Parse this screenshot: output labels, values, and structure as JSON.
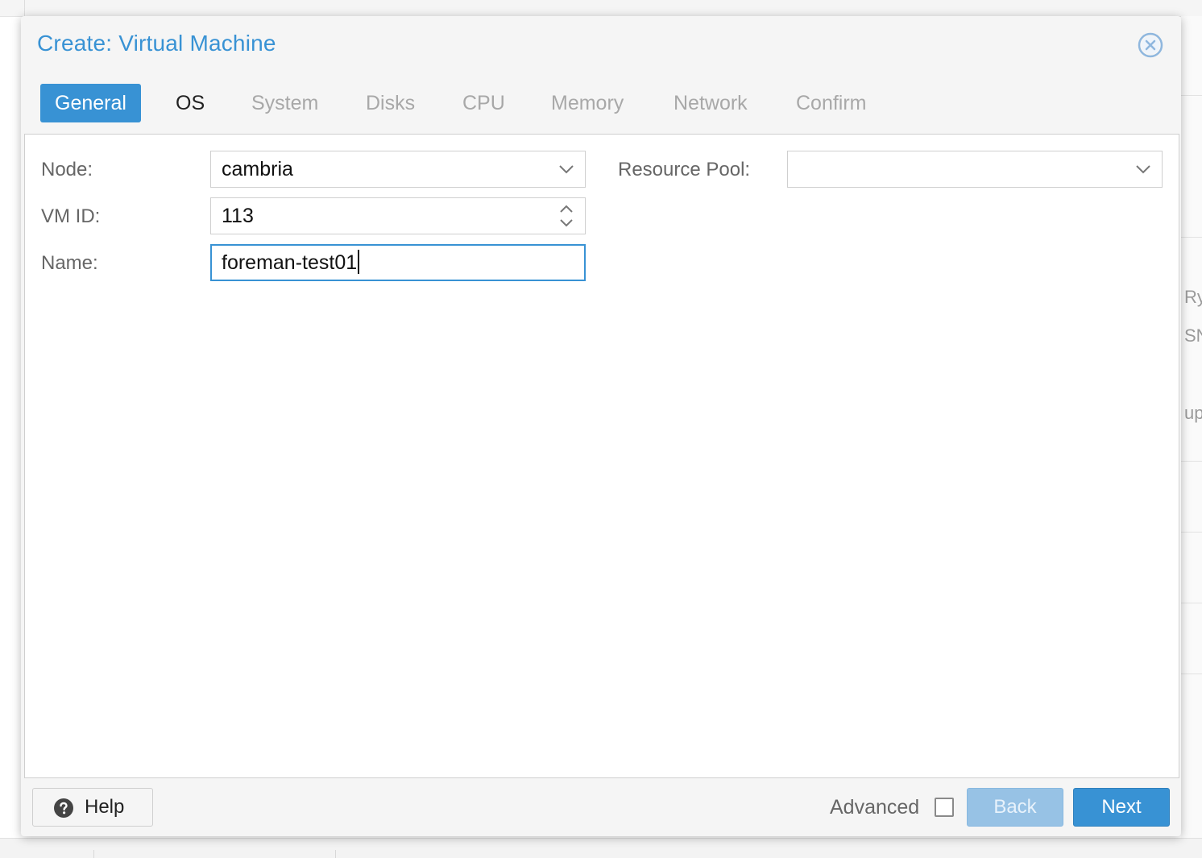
{
  "background": {
    "right_text": [
      "Ry",
      "SN",
      "up"
    ]
  },
  "dialog": {
    "title": "Create: Virtual Machine",
    "close_icon": "close-circle-icon"
  },
  "tabs": [
    {
      "label": "General",
      "state": "active"
    },
    {
      "label": "OS",
      "state": "enabled"
    },
    {
      "label": "System",
      "state": "disabled"
    },
    {
      "label": "Disks",
      "state": "disabled"
    },
    {
      "label": "CPU",
      "state": "disabled"
    },
    {
      "label": "Memory",
      "state": "disabled"
    },
    {
      "label": "Network",
      "state": "disabled"
    },
    {
      "label": "Confirm",
      "state": "disabled"
    }
  ],
  "form": {
    "node": {
      "label": "Node:",
      "value": "cambria"
    },
    "vmid": {
      "label": "VM ID:",
      "value": "113"
    },
    "name": {
      "label": "Name:",
      "value": "foreman-test01"
    },
    "resource_pool": {
      "label": "Resource Pool:",
      "value": ""
    }
  },
  "footer": {
    "help_label": "Help",
    "advanced_label": "Advanced",
    "advanced_checked": false,
    "back_label": "Back",
    "next_label": "Next"
  },
  "colors": {
    "accent": "#3892d4",
    "disabled_button": "#97c2e5"
  }
}
